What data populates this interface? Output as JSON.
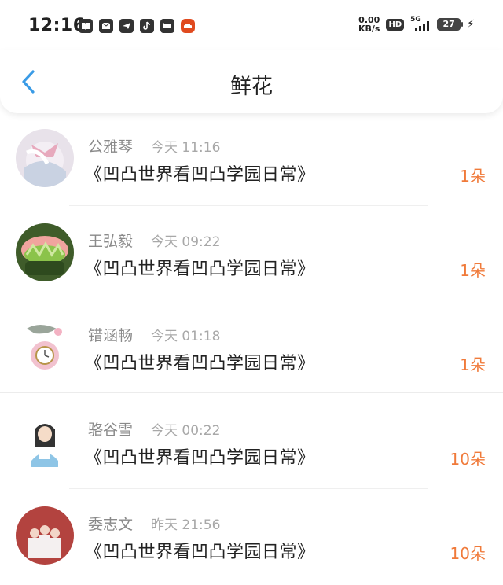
{
  "status_bar": {
    "time": "12:16",
    "net_speed_value": "0.00",
    "net_speed_unit": "KB/s",
    "hd_label": "HD",
    "network_label": "5G",
    "battery": "27",
    "notification_icons": [
      "book-icon",
      "mail-icon",
      "telegram-icon",
      "tiktok-icon",
      "cat-icon",
      "car-icon"
    ]
  },
  "header": {
    "title": "鲜花",
    "back_icon": "chevron-left-icon",
    "accent_color": "#3a9be6"
  },
  "rows": [
    {
      "name": "公雅琴",
      "time": "今天 11:16",
      "book": "《凹凸世界看凹凸学园日常》",
      "count": "1朵"
    },
    {
      "name": "王弘毅",
      "time": "今天 09:22",
      "book": "《凹凸世界看凹凸学园日常》",
      "count": "1朵"
    },
    {
      "name": "错涵畅",
      "time": "今天 01:18",
      "book": "《凹凸世界看凹凸学园日常》",
      "count": "1朵"
    },
    {
      "name": "骆谷雪",
      "time": "今天 00:22",
      "book": "《凹凸世界看凹凸学园日常》",
      "count": "10朵"
    },
    {
      "name": "委志文",
      "time": "昨天 21:56",
      "book": "《凹凸世界看凹凸学园日常》",
      "count": "10朵"
    }
  ],
  "colors": {
    "count": "#f07a3a",
    "name": "#8a8a8a",
    "time": "#a8a8a8"
  }
}
